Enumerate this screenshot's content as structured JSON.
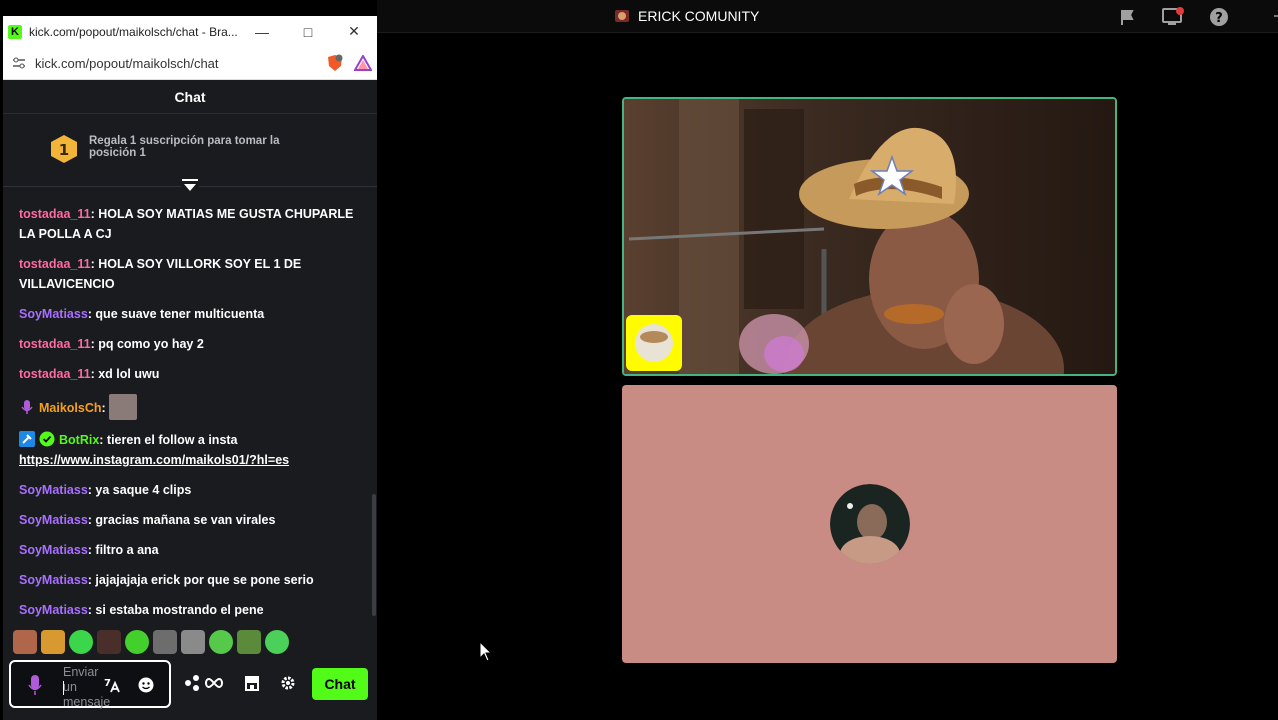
{
  "window": {
    "title": "kick.com/popout/maikolsch/chat - Bra...",
    "favicon_letter": "K",
    "url": "kick.com/popout/maikolsch/chat",
    "controls": [
      "minimize-icon",
      "maximize-icon",
      "close-icon"
    ]
  },
  "chat": {
    "header": "Chat",
    "gift": {
      "rank": "1",
      "text": "Regala 1 suscripción para tomar la posición 1"
    },
    "messages": [
      {
        "user": "tostadaa_11",
        "text": "HOLA SOY MATIAS ME GUSTA CHUPARLE LA POLLA A CJ",
        "color": "#ff6b9d"
      },
      {
        "user": "tostadaa_11",
        "text": "HOLA SOY VILLORK SOY EL 1 DE VILLAVICENCIO",
        "color": "#ff6b9d"
      },
      {
        "user": "SoyMatiass",
        "text": "que suave tener multicuenta",
        "color": "#a970ff"
      },
      {
        "user": "tostadaa_11",
        "text": "pq como yo hay 2",
        "color": "#ff6b9d"
      },
      {
        "user": "tostadaa_11",
        "text": "xd lol uwu",
        "color": "#ff6b9d"
      },
      {
        "user": "MaikolsCh",
        "text": "",
        "color": "#f7a11b",
        "badge": "microphone-icon",
        "has_emote": true
      },
      {
        "user": "BotRix",
        "text": "tieren el follow a insta",
        "link": "https://www.instagram.com/maikols01/?hl=es",
        "color": "#53fc18",
        "badges": [
          "hammer-icon",
          "verified-icon"
        ]
      },
      {
        "user": "SoyMatiass",
        "text": "ya saque 4 clips",
        "color": "#a970ff"
      },
      {
        "user": "SoyMatiass",
        "text": "gracias mañana se van virales",
        "color": "#a970ff"
      },
      {
        "user": "SoyMatiass",
        "text": "filtro a ana",
        "color": "#a970ff"
      },
      {
        "user": "SoyMatiass",
        "text": "jajajajaja erick por que se pone serio",
        "color": "#a970ff"
      },
      {
        "user": "SoyMatiass",
        "text": "si estaba mostrando el pene",
        "color": "#a970ff"
      }
    ],
    "input_placeholder": "Enviar un mensaje",
    "send_label": "Chat",
    "accent": "#53fc18"
  },
  "call": {
    "server_name": "ERICK COMUNITY",
    "speaking_color": "#43b581",
    "tile2_color": "#c98c84",
    "topbar_icons": [
      "flag-icon",
      "screen-share-icon",
      "help-icon"
    ]
  }
}
